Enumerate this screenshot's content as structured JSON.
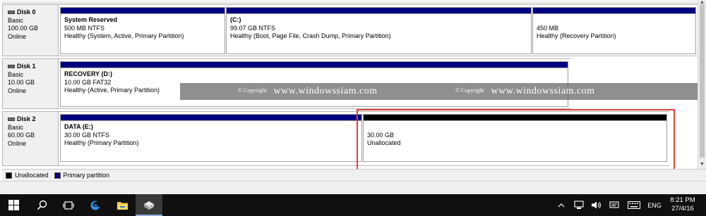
{
  "disks": [
    {
      "name": "Disk 0",
      "type": "Basic",
      "size": "100.00 GB",
      "status": "Online",
      "partitions": [
        {
          "name": "System Reserved",
          "detail": "500 MB NTFS",
          "status": "Healthy (System, Active, Primary Partition)",
          "bar": "primary"
        },
        {
          "name": "(C:)",
          "detail": "99.07 GB NTFS",
          "status": "Healthy (Boot, Page File, Crash Dump, Primary Partition)",
          "bar": "primary"
        },
        {
          "name": "",
          "detail": "450 MB",
          "status": "Healthy (Recovery Partition)",
          "bar": "primary"
        }
      ]
    },
    {
      "name": "Disk 1",
      "type": "Basic",
      "size": "10.00 GB",
      "status": "Online",
      "partitions": [
        {
          "name": "RECOVERY  (D:)",
          "detail": "10.00 GB FAT32",
          "status": "Healthy (Active, Primary Partition)",
          "bar": "primary"
        }
      ]
    },
    {
      "name": "Disk 2",
      "type": "Basic",
      "size": "60.00 GB",
      "status": "Online",
      "partitions": [
        {
          "name": "DATA  (E:)",
          "detail": "30.00 GB NTFS",
          "status": "Healthy (Primary Partition)",
          "bar": "primary"
        },
        {
          "name": "",
          "detail": "30.00 GB",
          "status": "Unallocated",
          "bar": "unallocated"
        }
      ]
    }
  ],
  "watermark": {
    "copyright": "© Copyright",
    "url": "www.windowssiam.com"
  },
  "legend": [
    {
      "label": "Unallocated",
      "color": "#000000"
    },
    {
      "label": "Primary partition",
      "color": "#00007f"
    }
  ],
  "taskbar": {
    "time": "8:21 PM",
    "date": "27/4/16",
    "language": "ENG"
  },
  "colors": {
    "primary_bar": "#00007f",
    "unallocated_bar": "#000000",
    "highlight": "#e0403a",
    "taskbar": "#101010"
  }
}
